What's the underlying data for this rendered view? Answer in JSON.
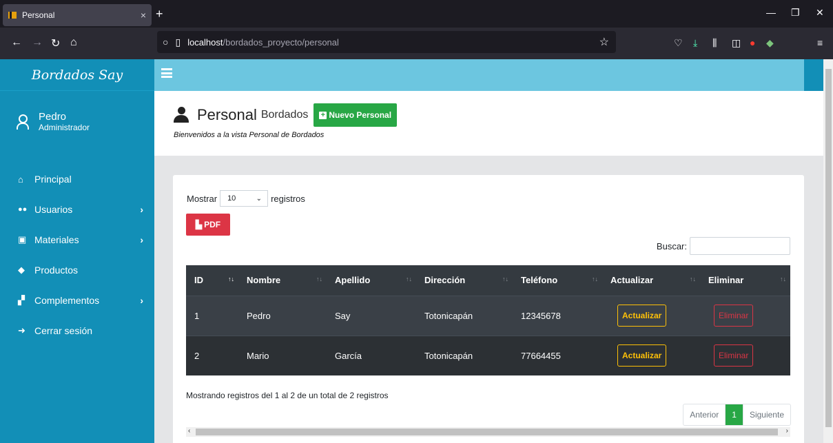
{
  "browser": {
    "tab_title": "Personal",
    "tab_close": "×",
    "new_tab": "+",
    "url_host": "localhost",
    "url_path": "/bordados_proyecto/personal"
  },
  "sidebar": {
    "brand": "Bordados Say",
    "user_name": "Pedro",
    "user_role": "Administrador",
    "items": [
      {
        "label": "Principal",
        "icon": "home-icon",
        "glyph": "⌂",
        "has_chevron": false
      },
      {
        "label": "Usuarios",
        "icon": "users-icon",
        "glyph": "👥",
        "has_chevron": true
      },
      {
        "label": "Materiales",
        "icon": "toolbox-icon",
        "glyph": "▣",
        "has_chevron": true
      },
      {
        "label": "Productos",
        "icon": "shopping-bag-icon",
        "glyph": "◆",
        "has_chevron": false
      },
      {
        "label": "Complementos",
        "icon": "dolly-icon",
        "glyph": "▞",
        "has_chevron": true
      },
      {
        "label": "Cerrar sesión",
        "icon": "sign-out-icon",
        "glyph": "➜",
        "has_chevron": false
      }
    ]
  },
  "header": {
    "title": "Personal",
    "subtitle": "Bordados",
    "new_button": "Nuevo Personal",
    "welcome": "Bienvenidos a la vista Personal de Bordados"
  },
  "table_controls": {
    "show_label": "Mostrar",
    "page_size": "10",
    "records_label": "registros",
    "pdf_button": "PDF",
    "search_label": "Buscar:"
  },
  "table": {
    "columns": [
      "ID",
      "Nombre",
      "Apellido",
      "Dirección",
      "Teléfono",
      "Actualizar",
      "Eliminar"
    ],
    "rows": [
      {
        "id": "1",
        "nombre": "Pedro",
        "apellido": "Say",
        "direccion": "Totonicapán",
        "telefono": "12345678",
        "update": "Actualizar",
        "delete": "Eliminar"
      },
      {
        "id": "2",
        "nombre": "Mario",
        "apellido": "García",
        "direccion": "Totonicapán",
        "telefono": "77664455",
        "update": "Actualizar",
        "delete": "Eliminar"
      }
    ]
  },
  "footer": {
    "info": "Mostrando registros del 1 al 2 de un total de 2 registros",
    "prev": "Anterior",
    "page": "1",
    "next": "Siguiente"
  },
  "colors": {
    "sidebar": "#128fb7",
    "topbar": "#6cc6e0",
    "success": "#28a745",
    "danger": "#dc3545",
    "warning": "#ffc107"
  }
}
